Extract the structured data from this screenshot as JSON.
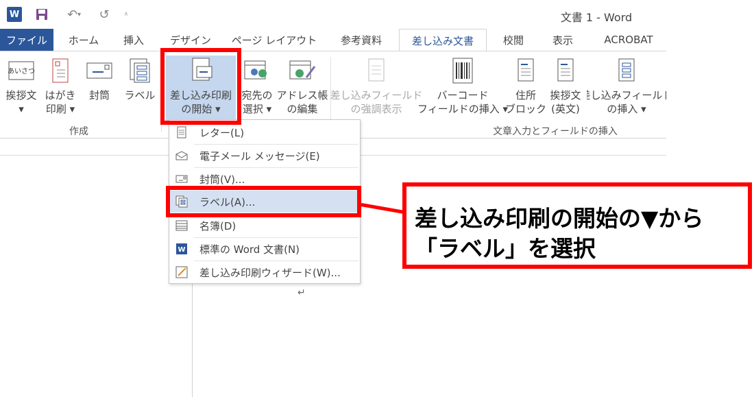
{
  "window": {
    "title": "文書 1 - Word",
    "app_icon": "word-icon"
  },
  "tabs": [
    {
      "label": "ファイル",
      "state": "file"
    },
    {
      "label": "ホーム"
    },
    {
      "label": "挿入"
    },
    {
      "label": "デザイン"
    },
    {
      "label": "ページ レイアウト"
    },
    {
      "label": "参考資料"
    },
    {
      "label": "差し込み文書",
      "state": "active"
    },
    {
      "label": "校閲"
    },
    {
      "label": "表示"
    },
    {
      "label": "ACROBAT"
    }
  ],
  "ribbon": {
    "groups": {
      "create": "作成",
      "write_insert": "文章入力とフィールドの挿入"
    },
    "buttons": {
      "greeting": "挨拶文\n▾",
      "postcard": "はがき\n印刷 ▾",
      "envelope": "封筒",
      "label": "ラベル",
      "start_merge": "差し込み印刷\nの開始 ▾",
      "select_recipients": "宛先の\n選択 ▾",
      "edit_list": "アドレス帳\nの編集",
      "highlight_fields": "差し込みフィールド\nの強調表示",
      "barcode": "バーコード\nフィールドの挿入 ▾",
      "address_block": "住所\nブロック",
      "greeting_en": "挨拶文\n(英文)",
      "insert_field": "差し込みフィールド\nの挿入 ▾"
    }
  },
  "dropdown": {
    "items": [
      {
        "label": "レター(L)",
        "icon": "letter-icon"
      },
      {
        "label": "電子メール メッセージ(E)",
        "icon": "email-icon"
      },
      {
        "label": "封筒(V)...",
        "icon": "envelope-icon"
      },
      {
        "label": "ラベル(A)...",
        "icon": "labels-icon",
        "highlighted": true
      },
      {
        "label": "名簿(D)",
        "icon": "directory-icon"
      },
      {
        "label": "標準の Word 文書(N)",
        "icon": "word-doc-icon"
      },
      {
        "label": "差し込み印刷ウィザード(W)...",
        "icon": "wizard-icon"
      }
    ]
  },
  "annotation": {
    "line1": "差し込み印刷の開始の▼から",
    "line2": "「ラベル」を選択",
    "color": "#ff0000"
  },
  "colors": {
    "accent": "#2b579a",
    "selected_button": "#c5d7ee",
    "highlight_item": "#d5e1f2"
  }
}
